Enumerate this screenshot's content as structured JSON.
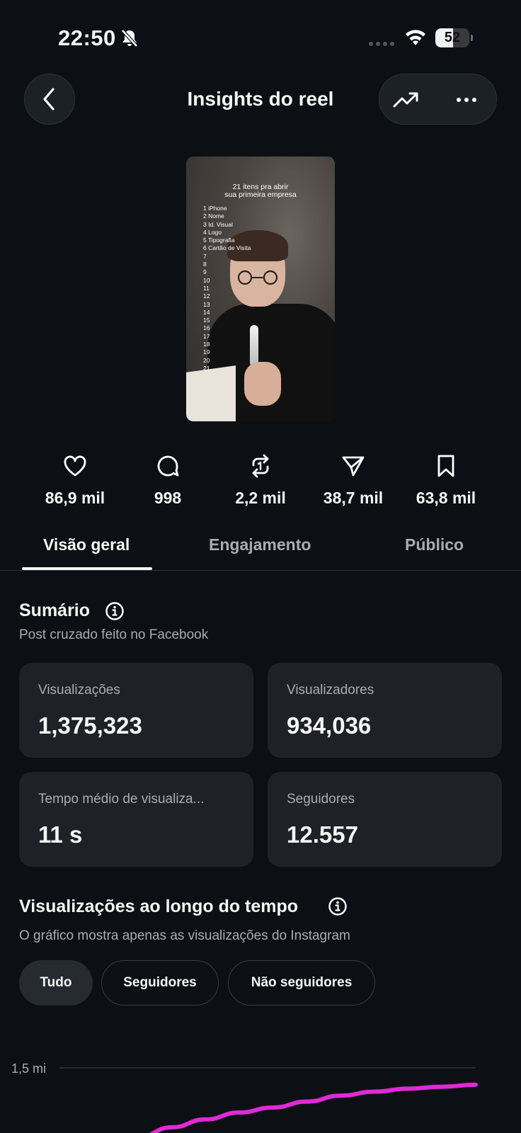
{
  "status_bar": {
    "time": "22:50",
    "battery": "52",
    "battery_level": 0.52
  },
  "header": {
    "title": "Insights do reel"
  },
  "thumbnail": {
    "title_line1": "21 itens pra abrir",
    "title_line2": "sua primeira empresa",
    "list": [
      "1 iPhone",
      "2 Nome",
      "3 Id. Visual",
      "4 Logo",
      "5 Tipografia",
      "6 Cartão de Visita",
      "7",
      "8",
      "9",
      "10",
      "11",
      "12",
      "13",
      "14",
      "15",
      "16",
      "17",
      "18",
      "19",
      "20",
      "21"
    ]
  },
  "stats": [
    {
      "icon": "heart-icon",
      "value": "86,9 mil"
    },
    {
      "icon": "comment-icon",
      "value": "998"
    },
    {
      "icon": "repost-icon",
      "value": "2,2 mil"
    },
    {
      "icon": "share-icon",
      "value": "38,7 mil"
    },
    {
      "icon": "bookmark-icon",
      "value": "63,8 mil"
    }
  ],
  "tabs": [
    "Visão geral",
    "Engajamento",
    "Público"
  ],
  "summary": {
    "title": "Sumário",
    "subtitle": "Post cruzado feito no Facebook",
    "cards": [
      {
        "label": "Visualizações",
        "value": "1,375,323"
      },
      {
        "label": "Visualizadores",
        "value": "934,036"
      },
      {
        "label": "Tempo médio de visualiza...",
        "value": "11 s"
      },
      {
        "label": "Seguidores",
        "value": "12.557"
      }
    ]
  },
  "views_over_time": {
    "title": "Visualizações ao longo do tempo",
    "subtitle": "O gráfico mostra apenas as visualizações do Instagram",
    "filters": [
      "Tudo",
      "Seguidores",
      "Não seguidores"
    ],
    "active_filter": "Tudo"
  },
  "chart_data": {
    "type": "line",
    "y_tick_labels": [
      "1,5 mi"
    ],
    "ylim": [
      0,
      1500000
    ],
    "series": [
      {
        "color": "#e02ad6",
        "values": [
          1150000,
          1200000,
          1240000,
          1275000,
          1300000,
          1330000,
          1360000,
          1380000,
          1395000,
          1405000,
          1415000
        ]
      }
    ]
  },
  "colors": {
    "background": "#0c1014",
    "card": "#1e2227",
    "accent_line": "#e02ad6"
  }
}
